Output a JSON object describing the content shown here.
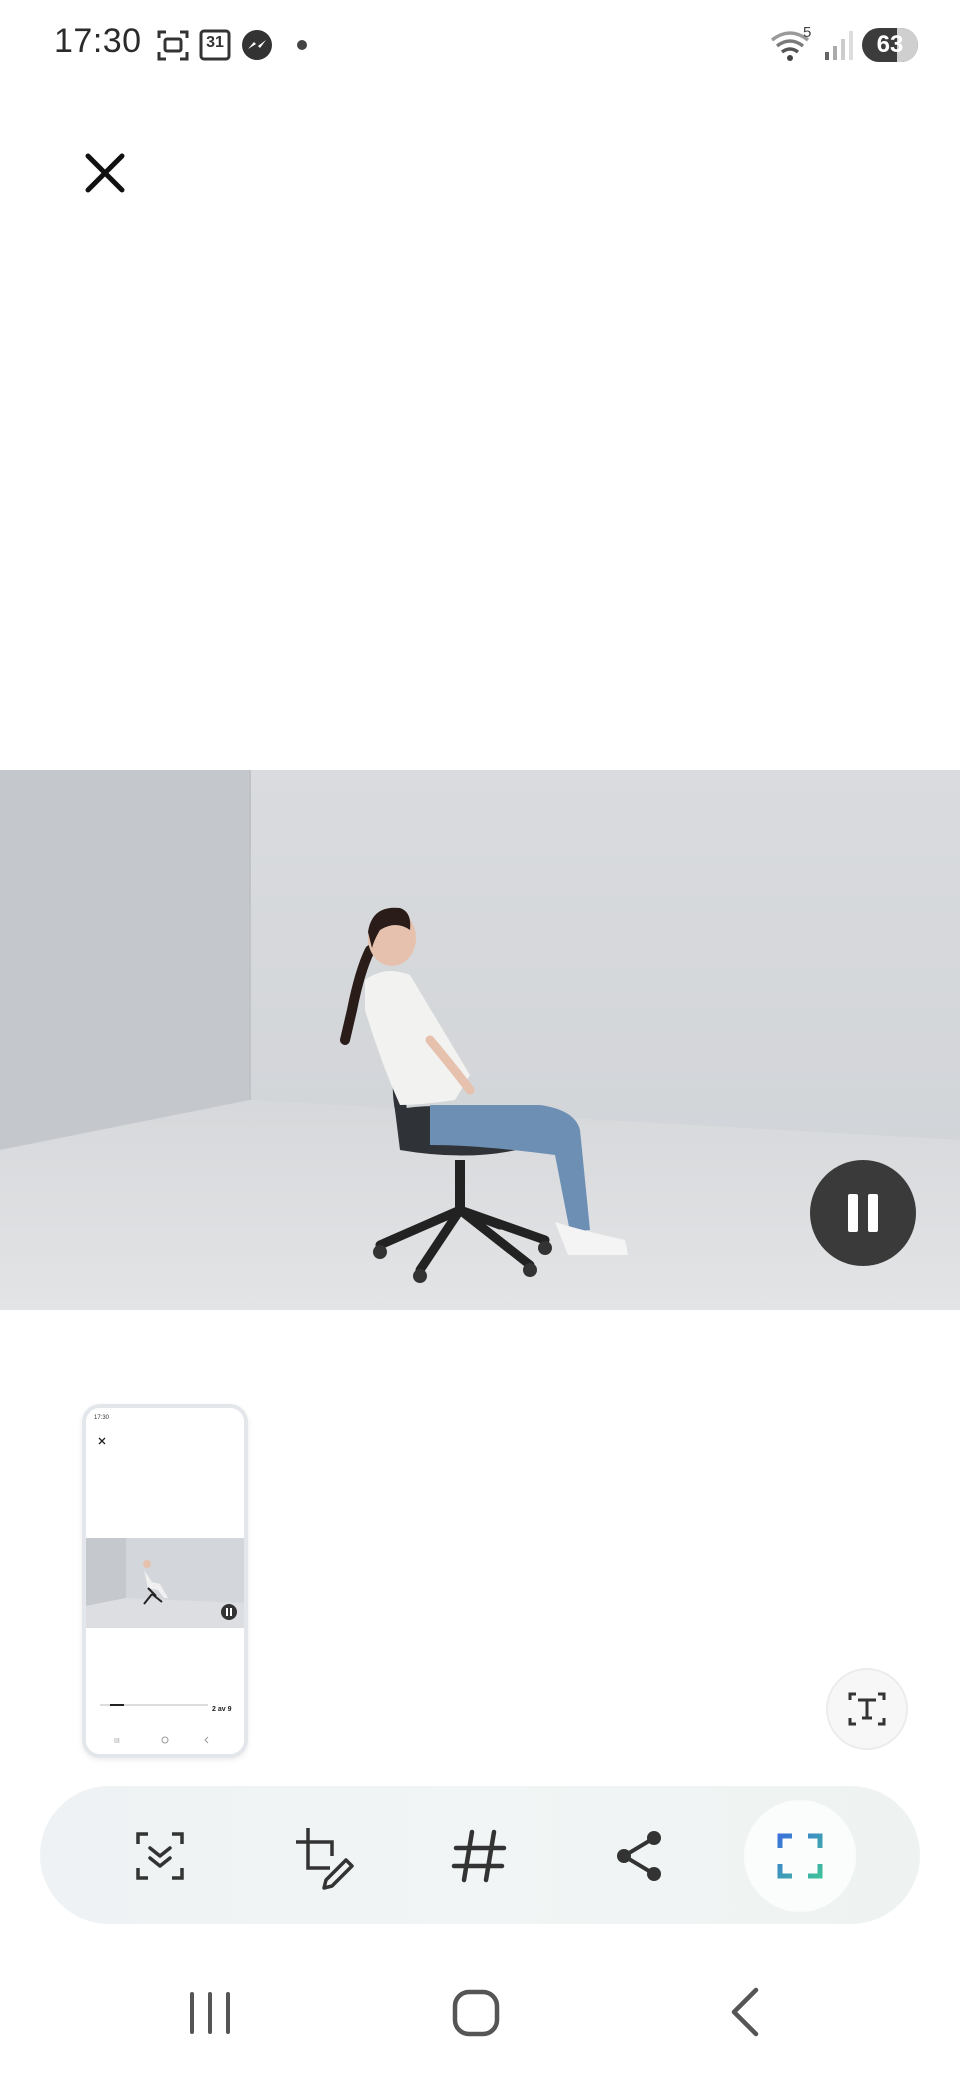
{
  "status_bar": {
    "time": "17:30",
    "calendar_day": "31",
    "wifi_badge": "5",
    "battery_level": "63",
    "icons": [
      "screen-capture-icon",
      "calendar-icon",
      "messenger-icon",
      "notification-dot-icon",
      "wifi-icon",
      "signal-icon",
      "battery-icon"
    ]
  },
  "viewer": {
    "close_icon": "close-icon",
    "video_state_icon": "pause-icon"
  },
  "thumbnail": {
    "page_indicator": "2 av 9"
  },
  "actions": {
    "text_extract_icon": "text-extract-icon",
    "toolbar": [
      {
        "name": "scroll-capture",
        "icon": "scroll-capture-icon"
      },
      {
        "name": "crop-edit",
        "icon": "crop-edit-icon"
      },
      {
        "name": "tag",
        "icon": "hashtag-icon"
      },
      {
        "name": "share",
        "icon": "share-icon"
      },
      {
        "name": "screen-select",
        "icon": "screen-select-icon"
      }
    ]
  },
  "nav_bar": {
    "items": [
      "recent-apps-icon",
      "home-icon",
      "back-icon"
    ]
  },
  "colors": {
    "accent_blue": "#3b73d9",
    "accent_green": "#3fbf9b",
    "pause_bg": "#3a3a3a"
  }
}
